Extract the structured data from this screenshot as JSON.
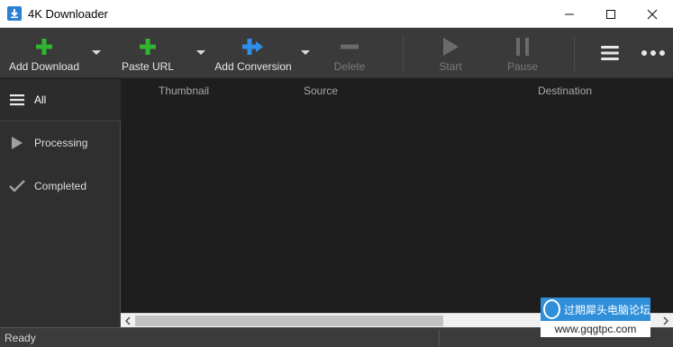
{
  "window": {
    "title": "4K Downloader"
  },
  "toolbar": {
    "add_download": "Add Download",
    "paste_url": "Paste URL",
    "add_conversion": "Add Conversion",
    "delete": "Delete",
    "start": "Start",
    "pause": "Pause",
    "icons": [
      "plus-icon",
      "plus-icon",
      "convert-plus-icon",
      "minus-icon",
      "play-icon",
      "pause-icon",
      "menu-icon",
      "more-icon"
    ],
    "colors": {
      "add": "#2fb52f",
      "convert": "#2f8fe8",
      "disabled": "#6b6b6b"
    }
  },
  "sidebar": {
    "header": "All",
    "items": [
      {
        "label": "Processing",
        "icon": "play-icon"
      },
      {
        "label": "Completed",
        "icon": "check-icon"
      }
    ]
  },
  "table": {
    "columns": [
      "Thumbnail",
      "Source",
      "Destination"
    ]
  },
  "status": {
    "text": "Ready"
  },
  "watermark": {
    "text": "过期犀头电脑论坛",
    "url": "www.gqgtpc.com"
  }
}
